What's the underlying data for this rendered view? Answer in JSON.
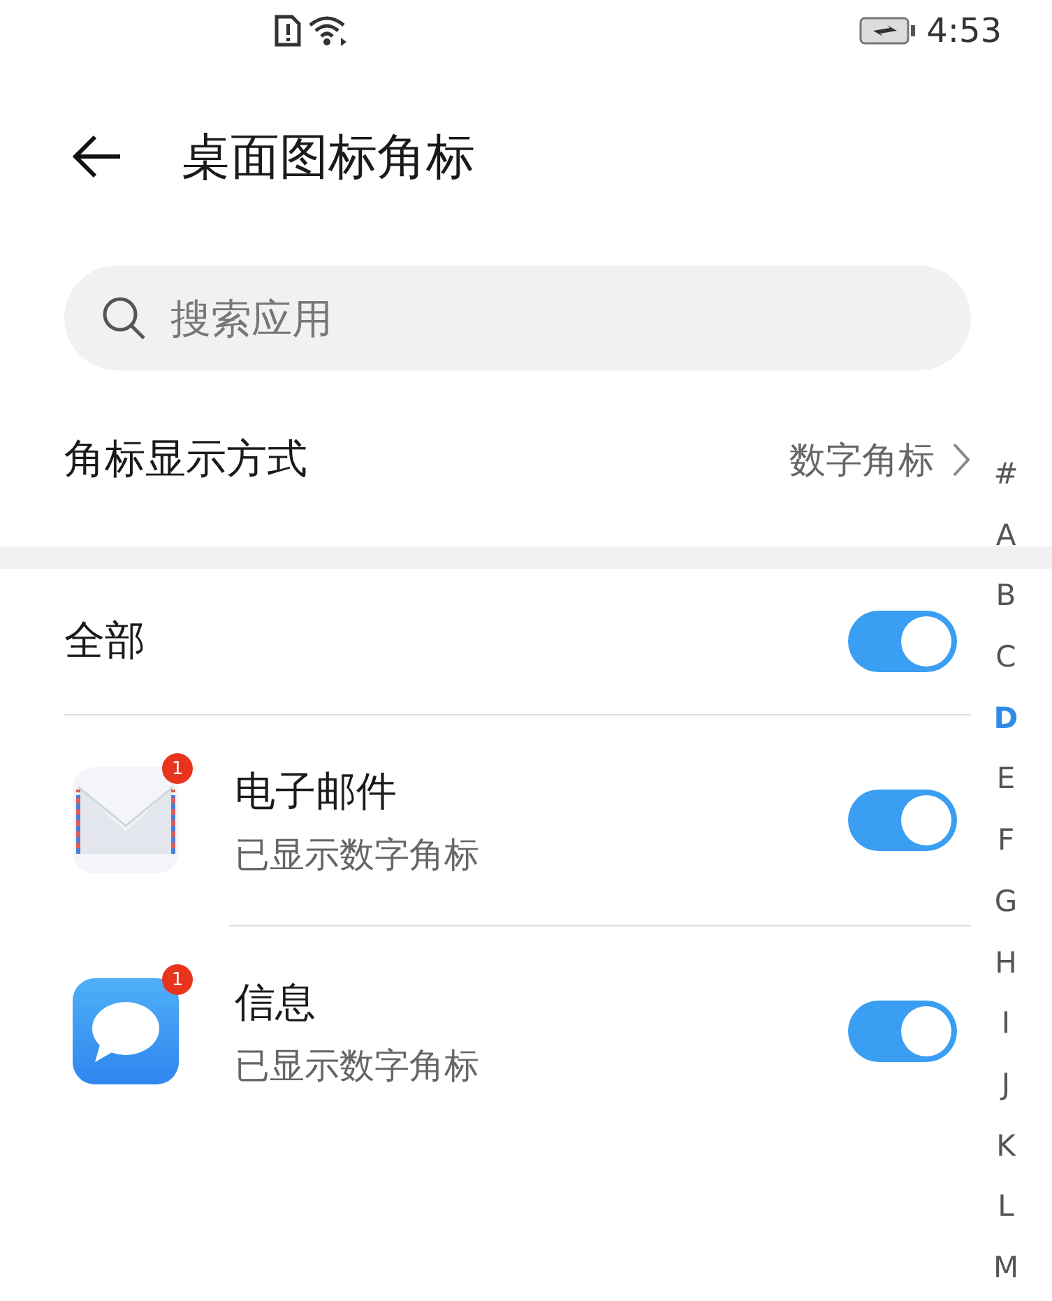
{
  "status_bar": {
    "time": "4:53"
  },
  "header": {
    "title": "桌面图标角标"
  },
  "search": {
    "placeholder": "搜索应用"
  },
  "badge_style": {
    "label": "角标显示方式",
    "value": "数字角标"
  },
  "all": {
    "label": "全部",
    "on": true
  },
  "apps": [
    {
      "name": "电子邮件",
      "status": "已显示数字角标",
      "kind": "mail",
      "badge": "1",
      "on": true
    },
    {
      "name": "信息",
      "status": "已显示数字角标",
      "kind": "message",
      "badge": "1",
      "on": true
    }
  ],
  "index": [
    {
      "label": "#",
      "selected": false
    },
    {
      "label": "A",
      "selected": false
    },
    {
      "label": "B",
      "selected": false
    },
    {
      "label": "C",
      "selected": false
    },
    {
      "label": "D",
      "selected": true
    },
    {
      "label": "E",
      "selected": false
    },
    {
      "label": "F",
      "selected": false
    },
    {
      "label": "G",
      "selected": false
    },
    {
      "label": "H",
      "selected": false
    },
    {
      "label": "I",
      "selected": false
    },
    {
      "label": "J",
      "selected": false
    },
    {
      "label": "K",
      "selected": false
    },
    {
      "label": "L",
      "selected": false
    },
    {
      "label": "M",
      "selected": false
    }
  ]
}
